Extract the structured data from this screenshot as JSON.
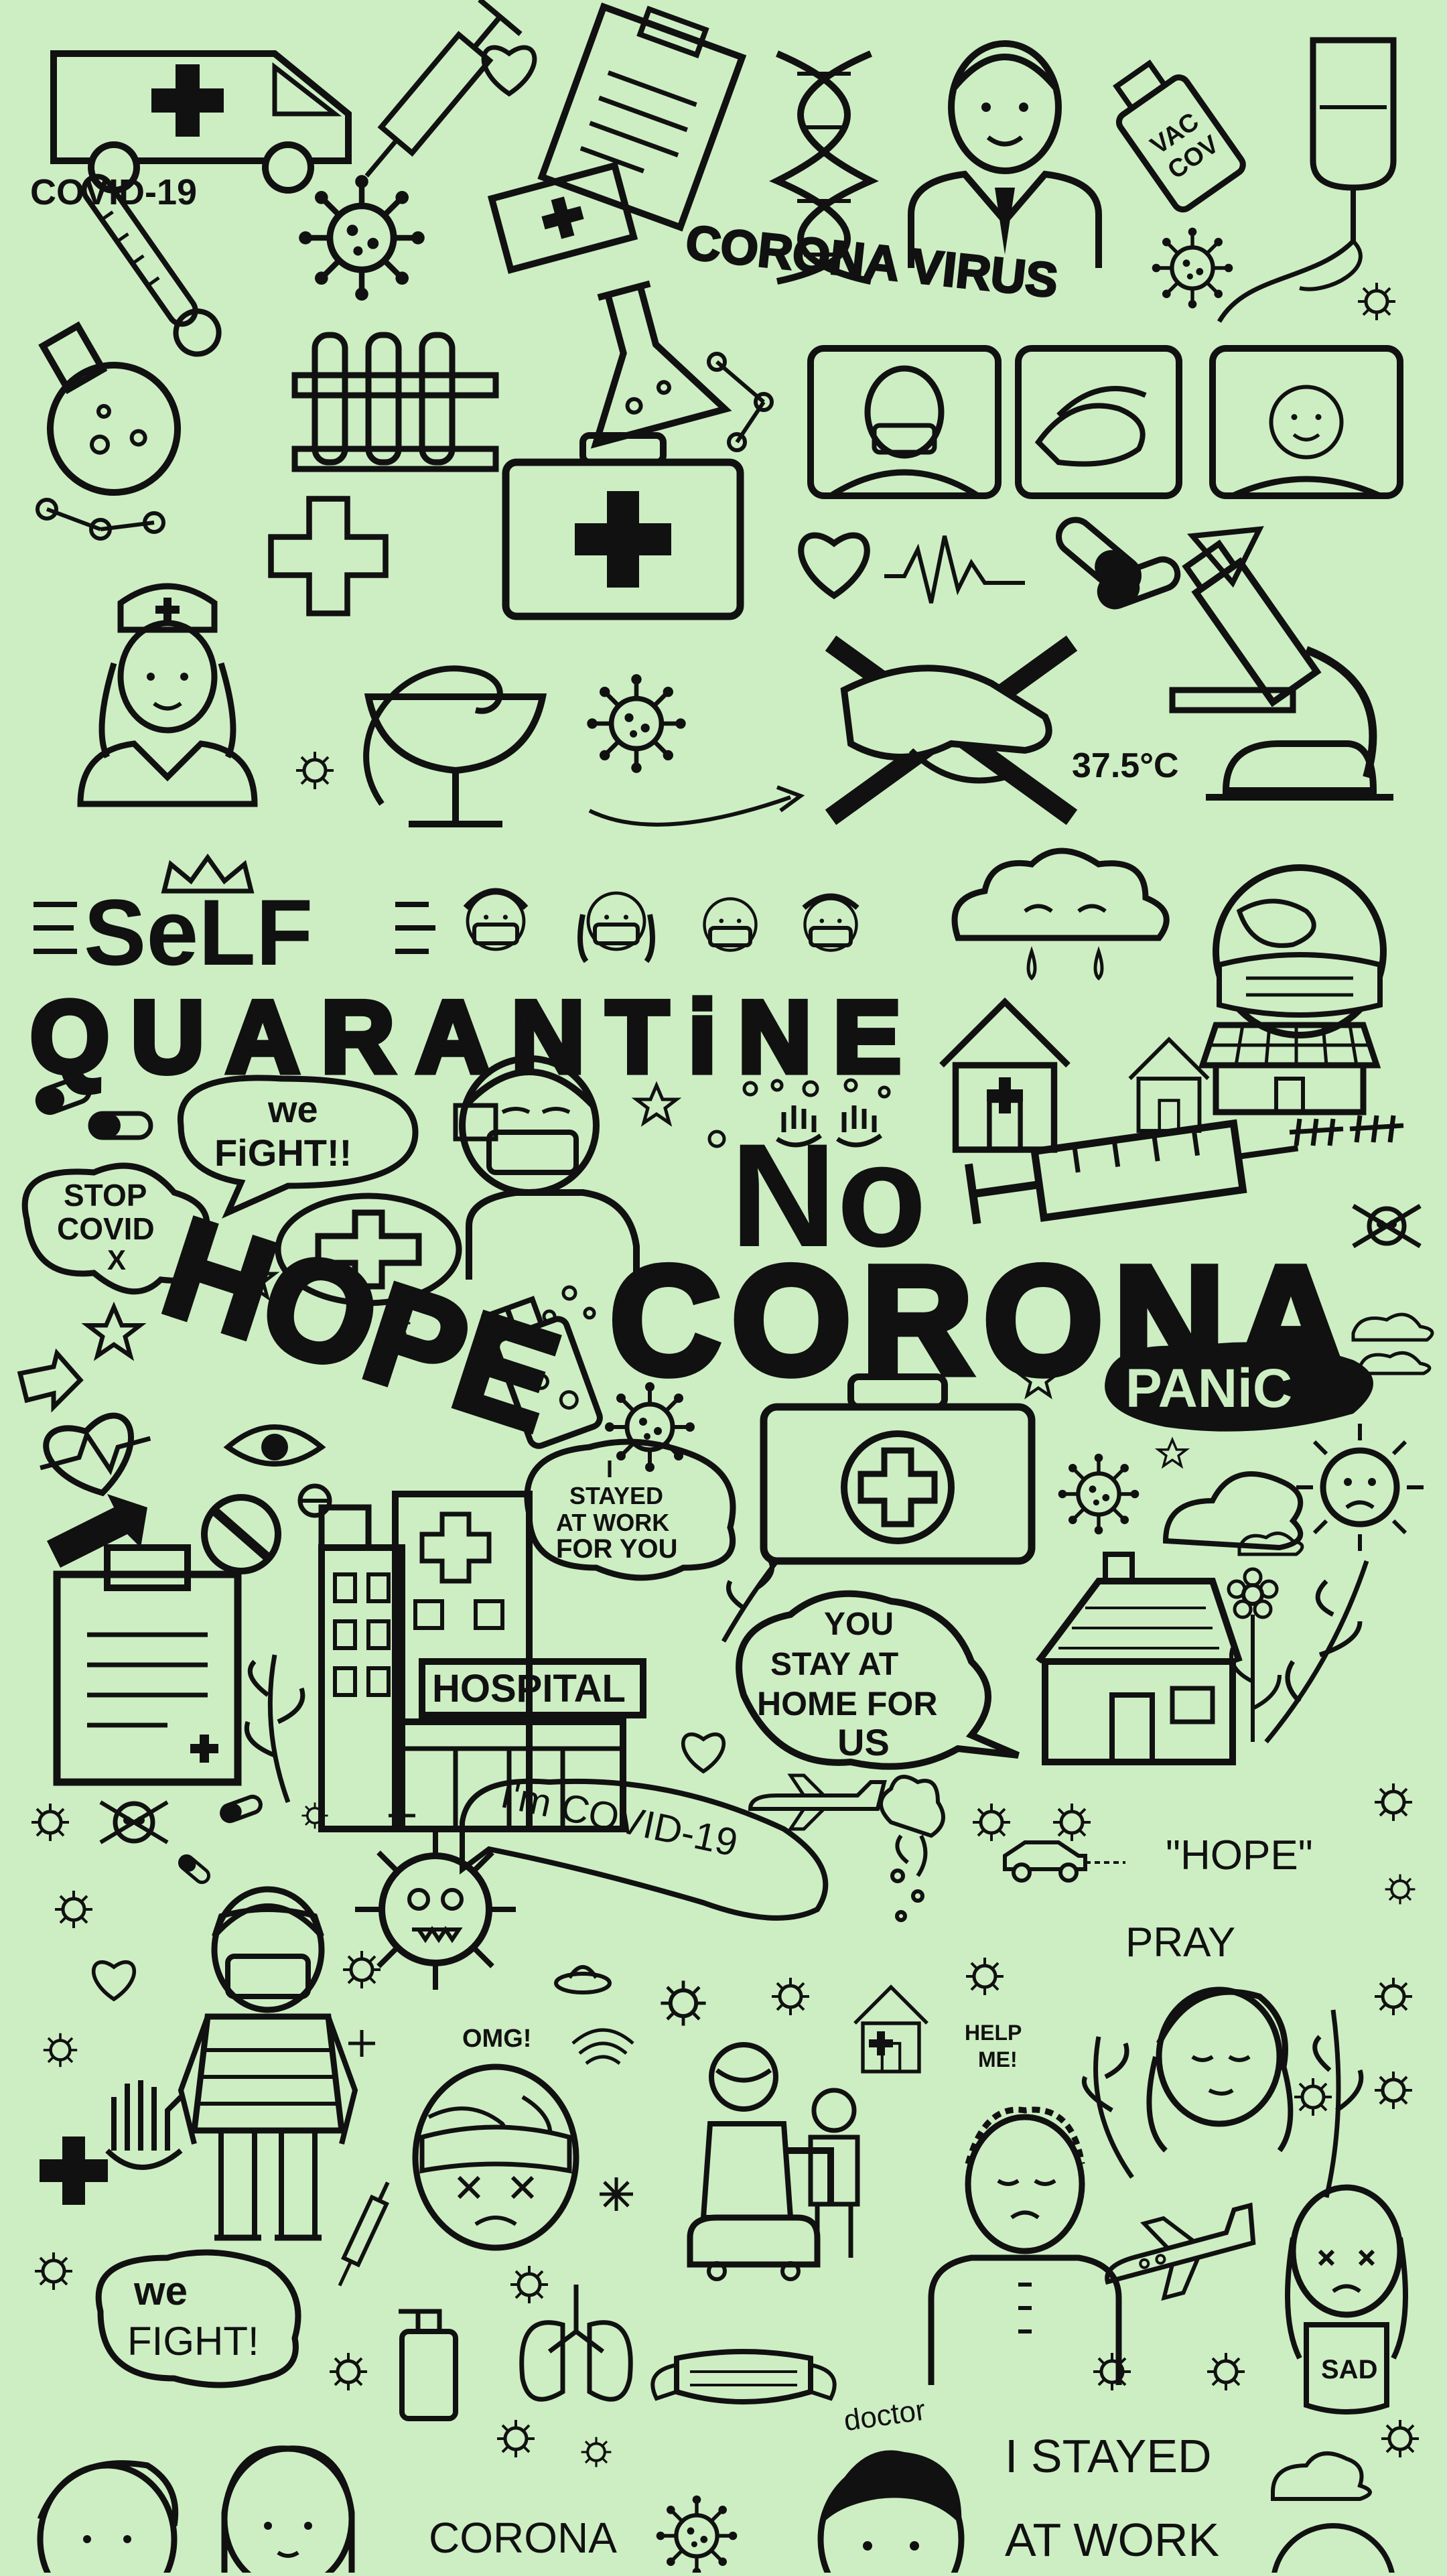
{
  "background_color": "#cdeec3",
  "ink_color": "#111111",
  "labels": {
    "covid19": "COVID-19",
    "corona_virus": "CORONA VIRUS",
    "vac_cov_1": "VAC",
    "vac_cov_2": "COV",
    "temperature": "37.5°C",
    "self": "SeLF",
    "quarantine": "QUARANTiNE",
    "we_fight_1a": "we",
    "we_fight_1b": "FiGHT!!",
    "stop_covid_1": "STOP",
    "stop_covid_2": "COVID",
    "stop_covid_3": "X",
    "no": "No",
    "corona_big": "CORONA",
    "panic": "PANiC",
    "hope_big": "HOPE",
    "stayed_bubble_1": "I",
    "stayed_bubble_2": "STAYED",
    "stayed_bubble_3": "AT WORK",
    "stayed_bubble_4": "FOR YOU",
    "hospital": "HOSPITAL",
    "you_stay_1": "YOU",
    "you_stay_2": "STAY AT",
    "you_stay_3": "HOME FOR",
    "you_stay_4": "US",
    "im_covid": "I'm COVID-19",
    "hope_quote": "\"HOPE\"",
    "pray": "PRAY",
    "omg": "OMG!",
    "help_me_1": "HELP",
    "help_me_2": "ME!",
    "we_fight_2a": "we",
    "we_fight_2b": "FIGHT!",
    "sad": "SAD",
    "doctor": "doctor",
    "corona_small": "CORONA",
    "i_stayed": "I STAYED",
    "at_work": "AT WORK"
  },
  "icons": [
    "ambulance-icon",
    "syringe-icon",
    "heart-icon",
    "clipboard-icon",
    "dna-icon",
    "doctor-icon",
    "vaccine-bottle-icon",
    "iv-bag-icon",
    "thermometer-icon",
    "virus-icon",
    "test-tubes-icon",
    "flask-icon",
    "first-aid-kit-icon",
    "medical-cross-icon",
    "nurse-icon",
    "pills-icon",
    "microscope-icon",
    "no-handshake-icon",
    "house-icon",
    "hospital-building-icon",
    "robot-icon",
    "globe-mask-icon",
    "lungs-icon",
    "face-mask-icon",
    "skull-icon"
  ]
}
